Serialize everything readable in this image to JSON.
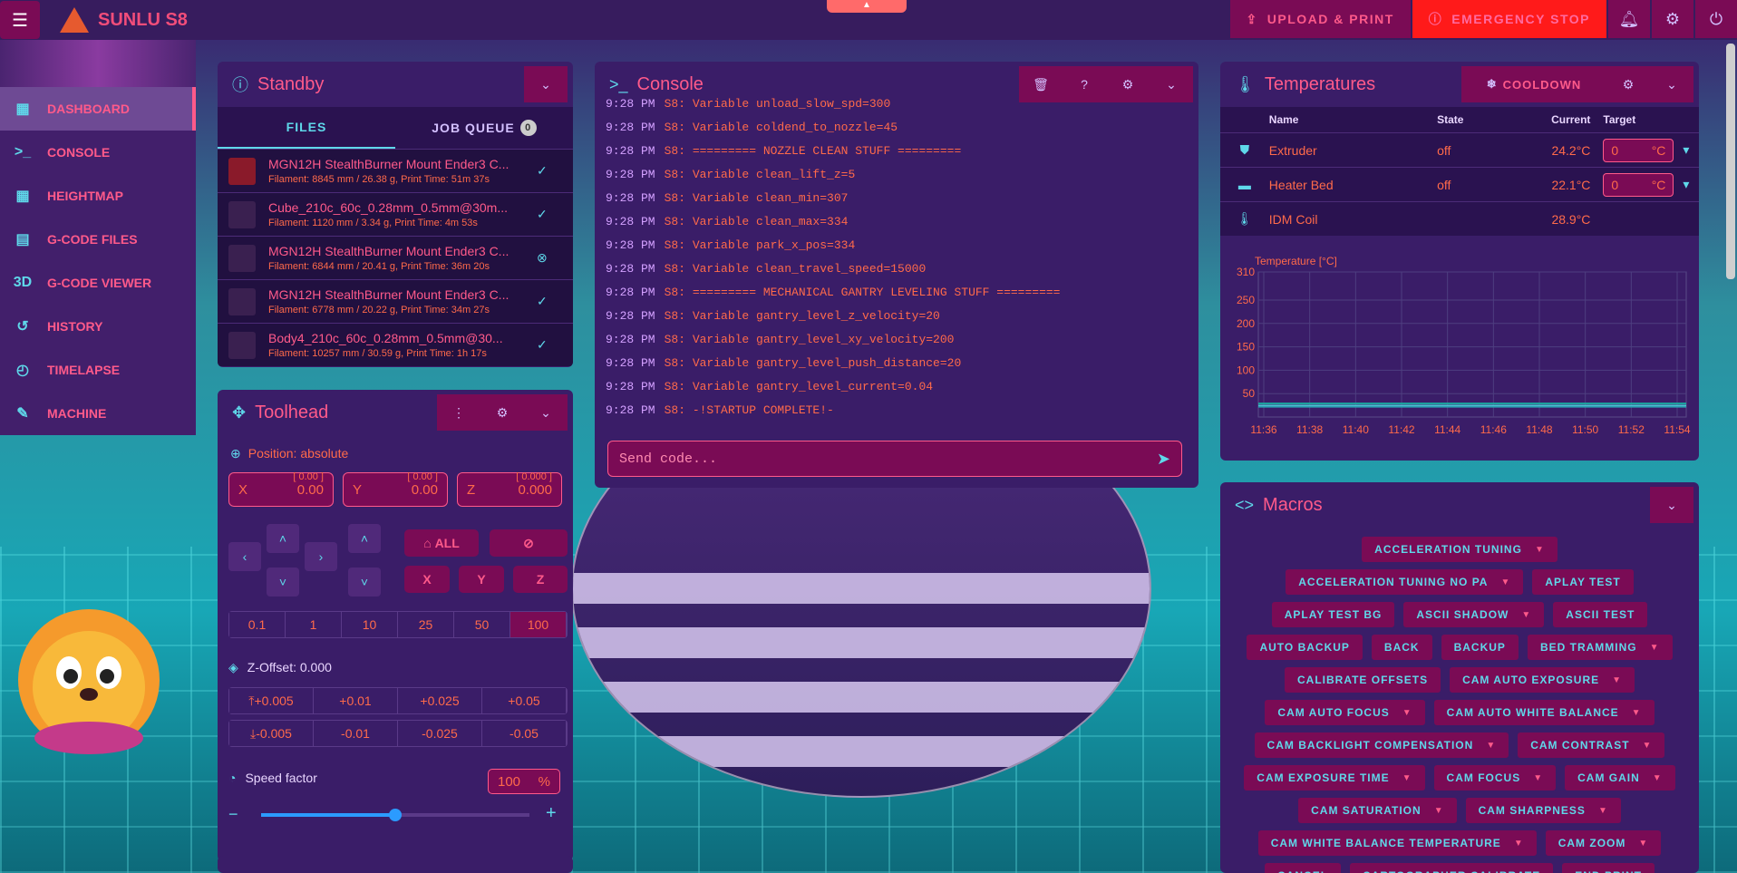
{
  "app": {
    "title": "SUNLU S8",
    "upload_label": "UPLOAD & PRINT",
    "estop_label": "EMERGENCY STOP",
    "colors": {
      "accent": "#ff5a8a",
      "cyan": "#5fd8ea",
      "panel": "#3a1d68",
      "button": "#7a0b55"
    }
  },
  "sidebar": {
    "items": [
      {
        "label": "DASHBOARD",
        "icon": "dashboard-icon",
        "glyph": "▦"
      },
      {
        "label": "CONSOLE",
        "icon": "console-icon",
        "glyph": ">_"
      },
      {
        "label": "HEIGHTMAP",
        "icon": "grid-icon",
        "glyph": "▦"
      },
      {
        "label": "G-CODE FILES",
        "icon": "file-icon",
        "glyph": "▤"
      },
      {
        "label": "G-CODE VIEWER",
        "icon": "3d-icon",
        "glyph": "3D"
      },
      {
        "label": "HISTORY",
        "icon": "history-icon",
        "glyph": "↺"
      },
      {
        "label": "TIMELAPSE",
        "icon": "timelapse-icon",
        "glyph": "◴"
      },
      {
        "label": "MACHINE",
        "icon": "wrench-icon",
        "glyph": "✎"
      }
    ]
  },
  "standby": {
    "title": "Standby",
    "tabs": {
      "files": "FILES",
      "queue": "JOB QUEUE",
      "queue_count": "0"
    },
    "files": [
      {
        "name": "MGN12H StealthBurner Mount Ender3 C...",
        "meta": "Filament: 8845 mm / 26.38 g, Print Time: 51m 37s",
        "status": "✓"
      },
      {
        "name": "Cube_210c_60c_0.28mm_0.5mm@30m...",
        "meta": "Filament: 1120 mm / 3.34 g, Print Time: 4m 53s",
        "status": "✓"
      },
      {
        "name": "MGN12H StealthBurner Mount Ender3 C...",
        "meta": "Filament: 6844 mm / 20.41 g, Print Time: 36m 20s",
        "status": "⊗"
      },
      {
        "name": "MGN12H StealthBurner Mount Ender3 C...",
        "meta": "Filament: 6778 mm / 20.22 g, Print Time: 34m 27s",
        "status": "✓"
      },
      {
        "name": "Body4_210c_60c_0.28mm_0.5mm@30...",
        "meta": "Filament: 10257 mm / 30.59 g, Print Time: 1h 17s",
        "status": "✓"
      }
    ]
  },
  "toolhead": {
    "title": "Toolhead",
    "position_label": "Position: absolute",
    "axes": [
      {
        "axis": "X",
        "value": "0.00",
        "target": "[ 0.00 ]"
      },
      {
        "axis": "Y",
        "value": "0.00",
        "target": "[ 0.00 ]"
      },
      {
        "axis": "Z",
        "value": "0.000",
        "target": "[ 0.000 ]"
      }
    ],
    "home_all": "ALL",
    "home_x": "X",
    "home_y": "Y",
    "home_z": "Z",
    "steps": [
      "0.1",
      "1",
      "10",
      "25",
      "50",
      "100"
    ],
    "zoffset_label": "Z-Offset: 0.000",
    "z_up": [
      "+0.005",
      "+0.01",
      "+0.025",
      "+0.05"
    ],
    "z_down": [
      "-0.005",
      "-0.01",
      "-0.025",
      "-0.05"
    ],
    "speed_label": "Speed factor",
    "speed_value": "100",
    "speed_unit": "%",
    "speed_fraction": 0.5
  },
  "console": {
    "title": "Console",
    "placeholder": "Send code...",
    "lines": [
      {
        "t": "9:28 PM",
        "m": "S8: Variable unload_slow_spd=300"
      },
      {
        "t": "9:28 PM",
        "m": "S8: Variable coldend_to_nozzle=45"
      },
      {
        "t": "9:28 PM",
        "m": "S8: ========= NOZZLE CLEAN STUFF ========="
      },
      {
        "t": "9:28 PM",
        "m": "S8: Variable clean_lift_z=5"
      },
      {
        "t": "9:28 PM",
        "m": "S8: Variable clean_min=307"
      },
      {
        "t": "9:28 PM",
        "m": "S8: Variable clean_max=334"
      },
      {
        "t": "9:28 PM",
        "m": "S8: Variable park_x_pos=334"
      },
      {
        "t": "9:28 PM",
        "m": "S8: Variable clean_travel_speed=15000"
      },
      {
        "t": "9:28 PM",
        "m": "S8: ========= MECHANICAL GANTRY LEVELING STUFF ========="
      },
      {
        "t": "9:28 PM",
        "m": "S8: Variable gantry_level_z_velocity=20"
      },
      {
        "t": "9:28 PM",
        "m": "S8: Variable gantry_level_xy_velocity=200"
      },
      {
        "t": "9:28 PM",
        "m": "S8: Variable gantry_level_push_distance=20"
      },
      {
        "t": "9:28 PM",
        "m": "S8: Variable gantry_level_current=0.04"
      },
      {
        "t": "9:28 PM",
        "m": "S8: -!STARTUP COMPLETE!-"
      }
    ]
  },
  "temperatures": {
    "title": "Temperatures",
    "cooldown": "COOLDOWN",
    "headers": {
      "name": "Name",
      "state": "State",
      "current": "Current",
      "target": "Target"
    },
    "rows": [
      {
        "name": "Extruder",
        "state": "off",
        "current": "24.2°C",
        "target": "0",
        "unit": "°C",
        "icon": "extruder-icon"
      },
      {
        "name": "Heater Bed",
        "state": "off",
        "current": "22.1°C",
        "target": "0",
        "unit": "°C",
        "icon": "heater-bed-icon"
      },
      {
        "name": "IDM Coil",
        "state": "",
        "current": "28.9°C",
        "target": "",
        "unit": "",
        "icon": "thermometer-icon"
      }
    ]
  },
  "chart_data": {
    "type": "line",
    "title": "",
    "ylabel": "Temperature [°C]",
    "xlabel": "",
    "x": [
      "11:36",
      "11:38",
      "11:40",
      "11:42",
      "11:44",
      "11:46",
      "11:48",
      "11:50",
      "11:52",
      "11:54"
    ],
    "yticks": [
      50,
      100,
      150,
      200,
      250,
      310
    ],
    "ylim": [
      0,
      310
    ],
    "series": [
      {
        "name": "",
        "values": [
          24,
          24,
          24,
          24,
          24,
          24,
          24,
          24,
          24,
          24
        ],
        "color": "#5fd8ea"
      },
      {
        "name": "",
        "values": [
          28.9,
          28.9,
          28.9,
          28.9,
          28.9,
          28.9,
          28.9,
          28.9,
          28.9,
          28.9
        ],
        "color": "#1aa8a0"
      },
      {
        "name": "",
        "values": [
          22.1,
          22.1,
          22.1,
          22.1,
          22.1,
          22.1,
          22.1,
          22.1,
          22.1,
          22.1
        ],
        "color": "#2aa0b0"
      }
    ],
    "grid": true
  },
  "macros": {
    "title": "Macros",
    "items": [
      {
        "label": "ACCELERATION TUNING",
        "dd": true
      },
      {
        "label": "ACCELERATION TUNING NO PA",
        "dd": true
      },
      {
        "label": "APLAY TEST",
        "dd": false
      },
      {
        "label": "APLAY TEST BG",
        "dd": false
      },
      {
        "label": "ASCII SHADOW",
        "dd": true
      },
      {
        "label": "ASCII TEST",
        "dd": false
      },
      {
        "label": "AUTO BACKUP",
        "dd": false
      },
      {
        "label": "BACK",
        "dd": false
      },
      {
        "label": "BACKUP",
        "dd": false
      },
      {
        "label": "BED TRAMMING",
        "dd": true
      },
      {
        "label": "CALIBRATE OFFSETS",
        "dd": false
      },
      {
        "label": "CAM AUTO EXPOSURE",
        "dd": true
      },
      {
        "label": "CAM AUTO FOCUS",
        "dd": true
      },
      {
        "label": "CAM AUTO WHITE BALANCE",
        "dd": true
      },
      {
        "label": "CAM BACKLIGHT COMPENSATION",
        "dd": true
      },
      {
        "label": "CAM CONTRAST",
        "dd": true
      },
      {
        "label": "CAM EXPOSURE TIME",
        "dd": true
      },
      {
        "label": "CAM FOCUS",
        "dd": true
      },
      {
        "label": "CAM GAIN",
        "dd": true
      },
      {
        "label": "CAM SATURATION",
        "dd": true
      },
      {
        "label": "CAM SHARPNESS",
        "dd": true
      },
      {
        "label": "CAM WHITE BALANCE TEMPERATURE",
        "dd": true
      },
      {
        "label": "CAM ZOOM",
        "dd": true
      },
      {
        "label": "CANCEL",
        "dd": false
      },
      {
        "label": "CARTOGRAPHER CALIBRATE",
        "dd": false
      },
      {
        "label": "END PRINT",
        "dd": false
      }
    ]
  }
}
